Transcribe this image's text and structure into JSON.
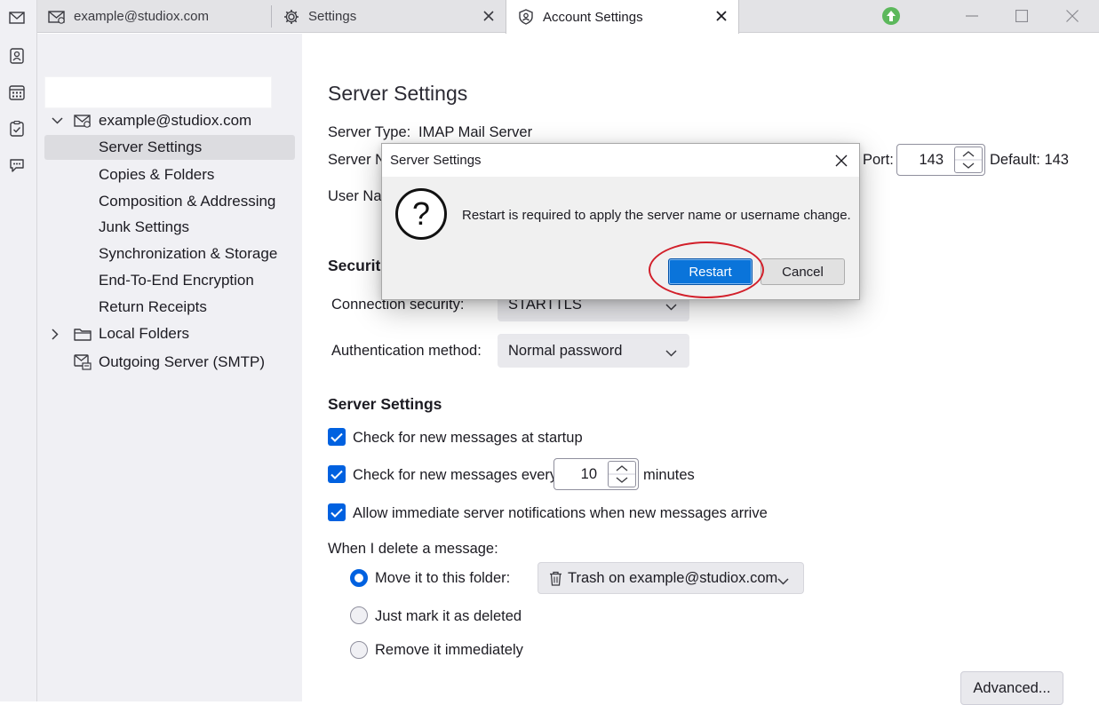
{
  "window": {
    "tabs": [
      {
        "label": "example@studiox.com",
        "icon": "mail-account-icon"
      },
      {
        "label": "Settings",
        "icon": "gear-icon"
      },
      {
        "label": "Account Settings",
        "icon": "account-settings-icon"
      }
    ],
    "accent": "#0061e0"
  },
  "spaces": [
    "mail-icon",
    "address-book-icon",
    "calendar-icon",
    "tasks-icon",
    "chat-icon"
  ],
  "sidebar": {
    "account": "example@studiox.com",
    "items": [
      "Server Settings",
      "Copies & Folders",
      "Composition & Addressing",
      "Junk Settings",
      "Synchronization & Storage",
      "End-To-End Encryption",
      "Return Receipts"
    ],
    "local_folders": "Local Folders",
    "outgoing": "Outgoing Server (SMTP)"
  },
  "main": {
    "title": "Server Settings",
    "server_type_label": "Server Type:",
    "server_type_value": "IMAP Mail Server",
    "server_name_label": "Server N",
    "user_name_label": "User Na",
    "port_label": "Port:",
    "port_value": "143",
    "port_default": "Default: 143",
    "security_heading": "Securit",
    "connection_security_label": "Connection security:",
    "connection_security_value": "STARTTLS",
    "auth_method_label": "Authentication method:",
    "auth_method_value": "Normal password",
    "server_settings_heading": "Server Settings",
    "check_startup": "Check for new messages at startup",
    "check_every": "Check for new messages every",
    "check_every_value": "10",
    "minutes": "minutes",
    "allow_notifications": "Allow immediate server notifications when new messages arrive",
    "delete_label": "When I delete a message:",
    "move_to_folder": "Move it to this folder:",
    "trash_folder": "Trash on example@studiox.com",
    "mark_deleted": "Just mark it as deleted",
    "remove_immediately": "Remove it immediately",
    "advanced_button": "Advanced..."
  },
  "dialog": {
    "title": "Server Settings",
    "message": "Restart is required to apply the server name or username change.",
    "icon_glyph": "?",
    "restart": "Restart",
    "cancel": "Cancel"
  }
}
